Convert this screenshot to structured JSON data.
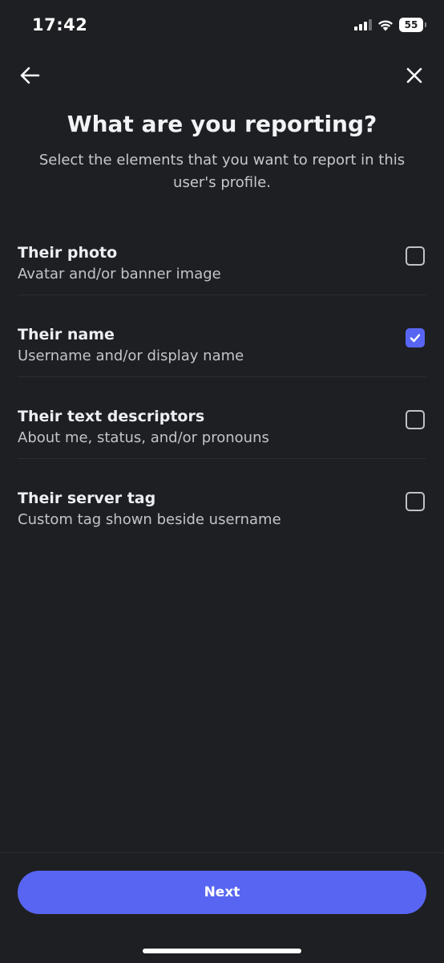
{
  "status_bar": {
    "time": "17:42",
    "battery": "55",
    "icons": [
      "cellular-signal-icon",
      "wifi-icon",
      "battery-icon"
    ]
  },
  "header": {
    "back_icon": "arrow-left-icon",
    "close_icon": "close-icon"
  },
  "title": "What are you reporting?",
  "subtitle": "Select the elements that you want to report in this user's profile.",
  "options": [
    {
      "title": "Their photo",
      "description": "Avatar and/or banner image",
      "checked": false
    },
    {
      "title": "Their name",
      "description": "Username and/or display name",
      "checked": true
    },
    {
      "title": "Their text descriptors",
      "description": "About me, status, and/or pronouns",
      "checked": false
    },
    {
      "title": "Their server tag",
      "description": "Custom tag shown beside username",
      "checked": false
    }
  ],
  "footer": {
    "next_label": "Next"
  },
  "colors": {
    "background": "#1e1f23",
    "accent": "#5865f2"
  }
}
